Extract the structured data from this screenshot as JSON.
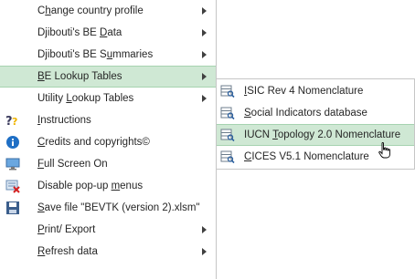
{
  "main_menu": {
    "items": [
      {
        "pre": "C",
        "key": "h",
        "post": "ange country profile"
      },
      {
        "pre": "Djibouti's BE ",
        "key": "D",
        "post": "ata"
      },
      {
        "pre": "Djibouti's BE S",
        "key": "u",
        "post": "mmaries"
      },
      {
        "pre": "",
        "key": "B",
        "post": "E Lookup Tables"
      },
      {
        "pre": "Utility ",
        "key": "L",
        "post": "ookup Tables"
      },
      {
        "pre": "",
        "key": "I",
        "post": "nstructions"
      },
      {
        "pre": "",
        "key": "C",
        "post": "redits and copyrights©"
      },
      {
        "pre": "",
        "key": "F",
        "post": "ull Screen On"
      },
      {
        "pre": "Disable pop-up ",
        "key": "m",
        "post": "enus"
      },
      {
        "pre": "",
        "key": "S",
        "post": "ave file \"BEVTK (version 2).xlsm\""
      },
      {
        "pre": "",
        "key": "P",
        "post": "rint/ Export"
      },
      {
        "pre": "",
        "key": "R",
        "post": "efresh data"
      }
    ]
  },
  "submenu": {
    "items": [
      {
        "pre": "",
        "key": "I",
        "post": "SIC Rev 4 Nomenclature"
      },
      {
        "pre": "",
        "key": "S",
        "post": "ocial Indicators database"
      },
      {
        "pre": "IUCN ",
        "key": "T",
        "post": "opology 2.0 Nomenclature"
      },
      {
        "pre": "",
        "key": "C",
        "post": "ICES V5.1 Nomenclature"
      }
    ]
  },
  "colors": {
    "highlight_bg": "#cfe8d4",
    "highlight_border": "#a6d3b0",
    "menu_border": "#c6c6c6"
  },
  "icons": {
    "instructions": "help-question-icon",
    "credits": "info-icon",
    "full_screen": "full-screen-icon",
    "disable_popup": "disable-menu-icon",
    "save": "floppy-disk-icon",
    "table_lookup": "table-search-icon"
  }
}
